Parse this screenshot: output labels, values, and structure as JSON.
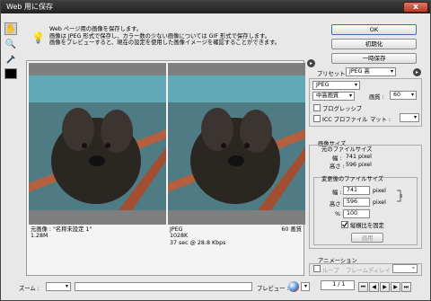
{
  "window": {
    "title": "Web 用に保存",
    "close_label": "x"
  },
  "tools": [
    {
      "name": "hand-icon",
      "glyph": "✋"
    },
    {
      "name": "zoom-icon",
      "glyph": "🔍"
    },
    {
      "name": "eyedropper-icon",
      "glyph": "⁄"
    }
  ],
  "message": {
    "line1": "Web ページ用の画像を保存します。",
    "line2": "画像は JPEG 形式で保存し、カラー数の少ない画像については GIF 形式で保存します。",
    "line3": "画像をプレビューすると、現在の設定を使用した画像イメージを確認することができます。"
  },
  "buttons": {
    "ok": "OK",
    "reset": "初期化",
    "save_temp": "一時保存",
    "apply": "適用"
  },
  "original": {
    "caption1": "元画像 : \"名称未設定 1\"",
    "caption2": "1.28M"
  },
  "optimized": {
    "format": "JPEG",
    "size": "1028K",
    "time": "37 sec @ 28.8 Kbps",
    "quality_label": "60 画質"
  },
  "settings": {
    "preset_label": "プリセット :",
    "preset_value": "JPEG 高",
    "format_value": "JPEG",
    "quality_name": "中高画質",
    "quality_label": "画質 :",
    "quality_value": "60",
    "progressive_label": "プログレッシブ",
    "icc_label": "ICC プロファイル",
    "matte_label": "マット :"
  },
  "image_size": {
    "section_label": "画像サイズ",
    "original_label": "元のファイルサイズ",
    "width_label": "幅 :",
    "width_value": "741 pixel",
    "height_label": "高さ :",
    "height_value": "596 pixel",
    "new_label": "変更後のファイルサイズ",
    "new_width": "741",
    "new_height": "596",
    "unit": "pixel",
    "percent_label": "% :",
    "percent_value": "100",
    "constrain_label": "縦横比を固定"
  },
  "animation": {
    "section_label": "アニメーション",
    "loop_label": "ループ",
    "delay_label": "フレームディレイ :",
    "frame_counter": "1 / 1"
  },
  "status": {
    "zoom_label": "ズーム :",
    "preview_label": "プレビュー :"
  }
}
